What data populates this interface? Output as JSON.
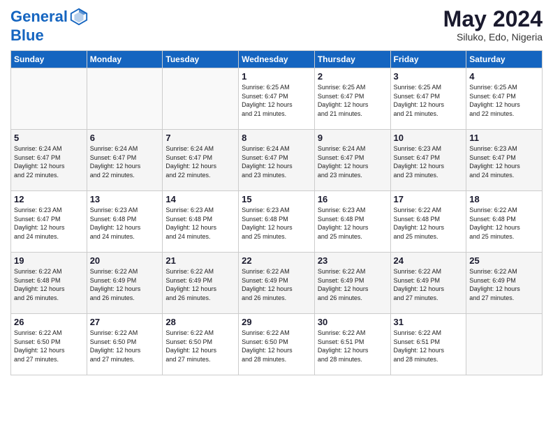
{
  "header": {
    "logo_line1": "General",
    "logo_line2": "Blue",
    "month_year": "May 2024",
    "location": "Siluko, Edo, Nigeria"
  },
  "weekdays": [
    "Sunday",
    "Monday",
    "Tuesday",
    "Wednesday",
    "Thursday",
    "Friday",
    "Saturday"
  ],
  "weeks": [
    [
      {
        "day": "",
        "info": ""
      },
      {
        "day": "",
        "info": ""
      },
      {
        "day": "",
        "info": ""
      },
      {
        "day": "1",
        "info": "Sunrise: 6:25 AM\nSunset: 6:47 PM\nDaylight: 12 hours\nand 21 minutes."
      },
      {
        "day": "2",
        "info": "Sunrise: 6:25 AM\nSunset: 6:47 PM\nDaylight: 12 hours\nand 21 minutes."
      },
      {
        "day": "3",
        "info": "Sunrise: 6:25 AM\nSunset: 6:47 PM\nDaylight: 12 hours\nand 21 minutes."
      },
      {
        "day": "4",
        "info": "Sunrise: 6:25 AM\nSunset: 6:47 PM\nDaylight: 12 hours\nand 22 minutes."
      }
    ],
    [
      {
        "day": "5",
        "info": "Sunrise: 6:24 AM\nSunset: 6:47 PM\nDaylight: 12 hours\nand 22 minutes."
      },
      {
        "day": "6",
        "info": "Sunrise: 6:24 AM\nSunset: 6:47 PM\nDaylight: 12 hours\nand 22 minutes."
      },
      {
        "day": "7",
        "info": "Sunrise: 6:24 AM\nSunset: 6:47 PM\nDaylight: 12 hours\nand 22 minutes."
      },
      {
        "day": "8",
        "info": "Sunrise: 6:24 AM\nSunset: 6:47 PM\nDaylight: 12 hours\nand 23 minutes."
      },
      {
        "day": "9",
        "info": "Sunrise: 6:24 AM\nSunset: 6:47 PM\nDaylight: 12 hours\nand 23 minutes."
      },
      {
        "day": "10",
        "info": "Sunrise: 6:23 AM\nSunset: 6:47 PM\nDaylight: 12 hours\nand 23 minutes."
      },
      {
        "day": "11",
        "info": "Sunrise: 6:23 AM\nSunset: 6:47 PM\nDaylight: 12 hours\nand 24 minutes."
      }
    ],
    [
      {
        "day": "12",
        "info": "Sunrise: 6:23 AM\nSunset: 6:47 PM\nDaylight: 12 hours\nand 24 minutes."
      },
      {
        "day": "13",
        "info": "Sunrise: 6:23 AM\nSunset: 6:48 PM\nDaylight: 12 hours\nand 24 minutes."
      },
      {
        "day": "14",
        "info": "Sunrise: 6:23 AM\nSunset: 6:48 PM\nDaylight: 12 hours\nand 24 minutes."
      },
      {
        "day": "15",
        "info": "Sunrise: 6:23 AM\nSunset: 6:48 PM\nDaylight: 12 hours\nand 25 minutes."
      },
      {
        "day": "16",
        "info": "Sunrise: 6:23 AM\nSunset: 6:48 PM\nDaylight: 12 hours\nand 25 minutes."
      },
      {
        "day": "17",
        "info": "Sunrise: 6:22 AM\nSunset: 6:48 PM\nDaylight: 12 hours\nand 25 minutes."
      },
      {
        "day": "18",
        "info": "Sunrise: 6:22 AM\nSunset: 6:48 PM\nDaylight: 12 hours\nand 25 minutes."
      }
    ],
    [
      {
        "day": "19",
        "info": "Sunrise: 6:22 AM\nSunset: 6:48 PM\nDaylight: 12 hours\nand 26 minutes."
      },
      {
        "day": "20",
        "info": "Sunrise: 6:22 AM\nSunset: 6:49 PM\nDaylight: 12 hours\nand 26 minutes."
      },
      {
        "day": "21",
        "info": "Sunrise: 6:22 AM\nSunset: 6:49 PM\nDaylight: 12 hours\nand 26 minutes."
      },
      {
        "day": "22",
        "info": "Sunrise: 6:22 AM\nSunset: 6:49 PM\nDaylight: 12 hours\nand 26 minutes."
      },
      {
        "day": "23",
        "info": "Sunrise: 6:22 AM\nSunset: 6:49 PM\nDaylight: 12 hours\nand 26 minutes."
      },
      {
        "day": "24",
        "info": "Sunrise: 6:22 AM\nSunset: 6:49 PM\nDaylight: 12 hours\nand 27 minutes."
      },
      {
        "day": "25",
        "info": "Sunrise: 6:22 AM\nSunset: 6:49 PM\nDaylight: 12 hours\nand 27 minutes."
      }
    ],
    [
      {
        "day": "26",
        "info": "Sunrise: 6:22 AM\nSunset: 6:50 PM\nDaylight: 12 hours\nand 27 minutes."
      },
      {
        "day": "27",
        "info": "Sunrise: 6:22 AM\nSunset: 6:50 PM\nDaylight: 12 hours\nand 27 minutes."
      },
      {
        "day": "28",
        "info": "Sunrise: 6:22 AM\nSunset: 6:50 PM\nDaylight: 12 hours\nand 27 minutes."
      },
      {
        "day": "29",
        "info": "Sunrise: 6:22 AM\nSunset: 6:50 PM\nDaylight: 12 hours\nand 28 minutes."
      },
      {
        "day": "30",
        "info": "Sunrise: 6:22 AM\nSunset: 6:51 PM\nDaylight: 12 hours\nand 28 minutes."
      },
      {
        "day": "31",
        "info": "Sunrise: 6:22 AM\nSunset: 6:51 PM\nDaylight: 12 hours\nand 28 minutes."
      },
      {
        "day": "",
        "info": ""
      }
    ]
  ]
}
